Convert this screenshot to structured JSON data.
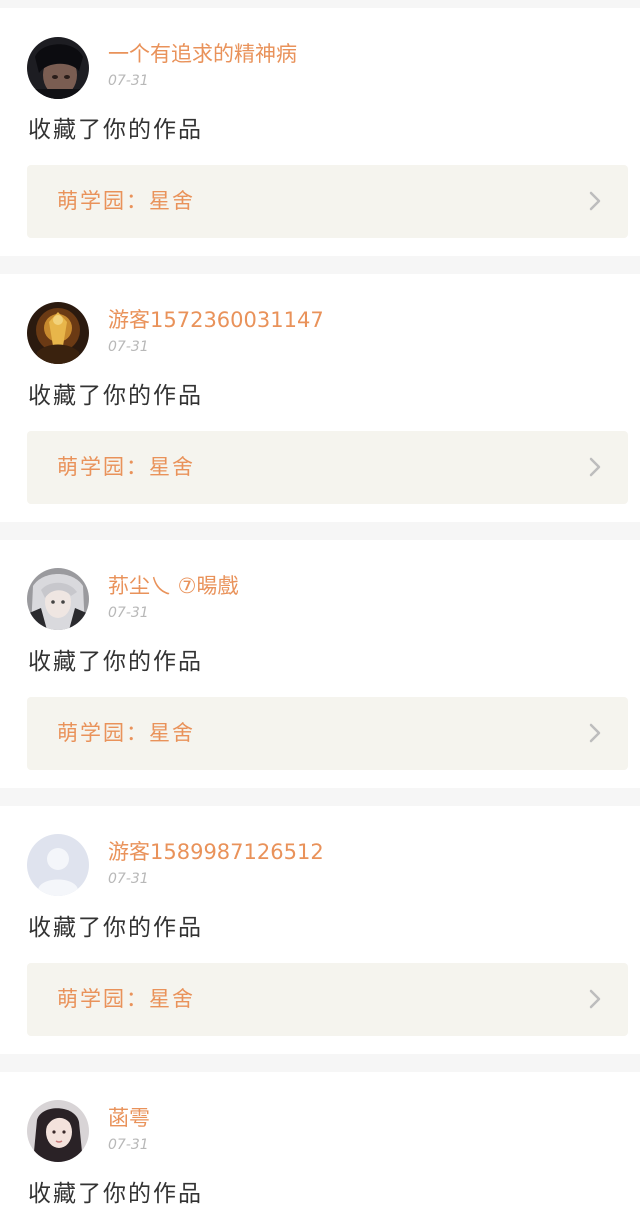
{
  "feed": {
    "items": [
      {
        "username": "一个有追求的精神病",
        "date": "07-31",
        "action": "收藏了你的作品",
        "link_label": "萌学园：星舍",
        "avatar": "avatar-dark-hair-boy"
      },
      {
        "username": "游客1572360031147",
        "date": "07-31",
        "action": "收藏了你的作品",
        "link_label": "萌学园：星舍",
        "avatar": "avatar-golden-figure"
      },
      {
        "username": "荪尘乀 ⑦暘戲",
        "date": "07-31",
        "action": "收藏了你的作品",
        "link_label": "萌学园：星舍",
        "avatar": "avatar-anime-silver-hair"
      },
      {
        "username": "游客1589987126512",
        "date": "07-31",
        "action": "收藏了你的作品",
        "link_label": "萌学园：星舍",
        "avatar": "avatar-default-person"
      },
      {
        "username": "菡雩",
        "date": "07-31",
        "action": "收藏了你的作品",
        "avatar": "avatar-girl-portrait"
      }
    ]
  },
  "colors": {
    "accent": "#e9925a",
    "page_background": "#f6f6f6",
    "card_background": "#ffffff",
    "link_box_background": "#f5f4ee",
    "date_text": "#b8b8b8",
    "body_text": "#333333",
    "chevron": "#bdbdbd"
  }
}
